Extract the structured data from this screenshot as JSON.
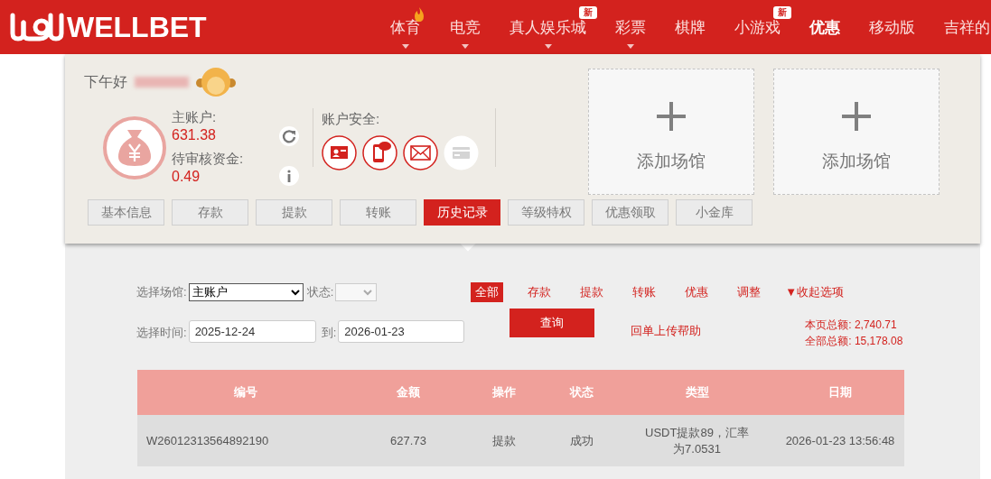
{
  "header": {
    "brand": "WELLBET",
    "nav": [
      {
        "label": "体育",
        "selected": false,
        "caret": true,
        "hot": true
      },
      {
        "label": "电竞",
        "selected": false,
        "caret": true,
        "hot": false
      },
      {
        "label": "真人娱乐城",
        "selected": false,
        "caret": true,
        "hot": false,
        "badge": "新"
      },
      {
        "label": "彩票",
        "selected": false,
        "caret": true,
        "hot": false
      },
      {
        "label": "棋牌",
        "selected": false,
        "caret": false,
        "hot": false
      },
      {
        "label": "小游戏",
        "selected": false,
        "caret": false,
        "hot": false,
        "badge": "新"
      },
      {
        "label": "优惠",
        "selected": true,
        "caret": false,
        "hot": false
      },
      {
        "label": "移动版",
        "selected": false,
        "caret": false,
        "hot": false
      },
      {
        "label": "吉祥的",
        "selected": false,
        "caret": false,
        "hot": false
      }
    ]
  },
  "account": {
    "greeting": "下午好",
    "main_label": "主账户:",
    "main_value": "631.38",
    "pending_label": "待审核资金:",
    "pending_value": "0.49",
    "security_label": "账户安全:",
    "security": [
      {
        "kind": "id",
        "on": true
      },
      {
        "kind": "sms",
        "on": true
      },
      {
        "kind": "email",
        "on": true
      },
      {
        "kind": "bank",
        "on": false
      }
    ]
  },
  "venues": [
    {
      "label": "添加场馆"
    },
    {
      "label": "添加场馆"
    }
  ],
  "tabs": [
    {
      "label": "基本信息",
      "selected": false
    },
    {
      "label": "存款",
      "selected": false
    },
    {
      "label": "提款",
      "selected": false
    },
    {
      "label": "转账",
      "selected": false
    },
    {
      "label": "历史记录",
      "selected": true
    },
    {
      "label": "等级特权",
      "selected": false
    },
    {
      "label": "优惠领取",
      "selected": false
    },
    {
      "label": "小金库",
      "selected": false
    }
  ],
  "filters": {
    "venue_label": "选择场馆:",
    "venue_value": "主账户",
    "status_label": "状态:",
    "time_label": "选择时间:",
    "from": "2025-12-24",
    "to_label": "到:",
    "to": "2026-01-23",
    "query_button": "查询",
    "help_link": "回单上传帮助",
    "collapse": "▼收起选项",
    "types": [
      {
        "label": "全部",
        "selected": true
      },
      {
        "label": "存款",
        "selected": false
      },
      {
        "label": "提款",
        "selected": false
      },
      {
        "label": "转账",
        "selected": false
      },
      {
        "label": "优惠",
        "selected": false
      },
      {
        "label": "调整",
        "selected": false
      }
    ],
    "totals": [
      "本页总额: 2,740.71",
      "全部总额: 15,178.08"
    ]
  },
  "table": {
    "columns": [
      "编号",
      "金额",
      "操作",
      "状态",
      "类型",
      "日期"
    ],
    "rows": [
      [
        "W26012313564892190",
        "627.73",
        "提款",
        "成功",
        "USDT提款89，汇率为7.0531",
        "2026-01-23 13:56:48"
      ]
    ]
  }
}
